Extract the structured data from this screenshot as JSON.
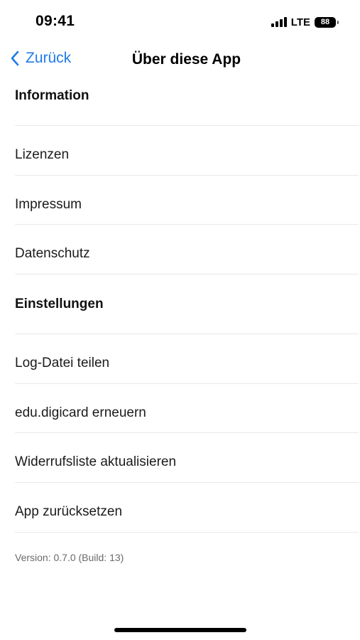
{
  "status_bar": {
    "time": "09:41",
    "network": "LTE",
    "battery": "88",
    "signal_icon": "cellular-signal-icon",
    "battery_icon": "battery-icon"
  },
  "nav": {
    "back_label": "Zurück",
    "back_icon": "chevron-left-icon",
    "title": "Über diese App"
  },
  "sections": [
    {
      "header": "Information",
      "items": [
        "Lizenzen",
        "Impressum",
        "Datenschutz"
      ]
    },
    {
      "header": "Einstellungen",
      "items": [
        "Log-Datei teilen",
        "edu.digicard erneuern",
        "Widerrufsliste aktualisieren",
        "App zurücksetzen"
      ]
    }
  ],
  "footer": {
    "version": "Version: 0.7.0 (Build: 13)"
  },
  "colors": {
    "accent": "#1f7be6",
    "divider": "#e9e9e9",
    "secondary_text": "#6a6a6a"
  }
}
